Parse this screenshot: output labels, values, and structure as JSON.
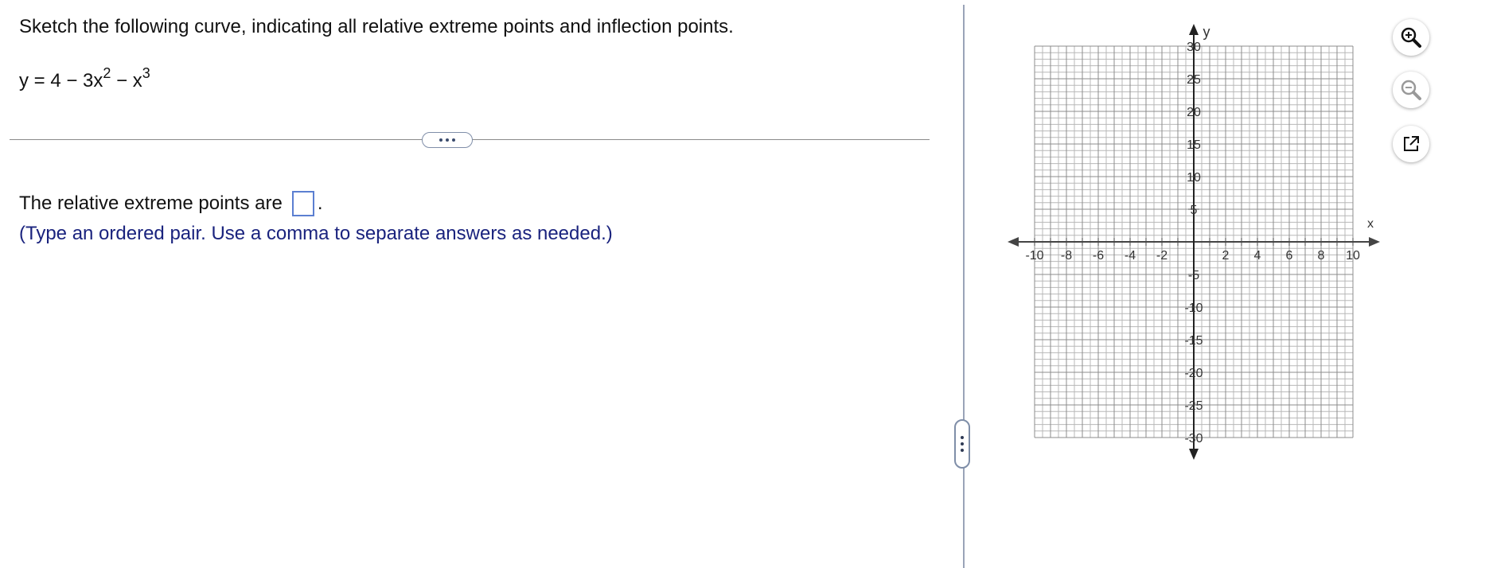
{
  "question": {
    "prompt": "Sketch the following curve, indicating all relative extreme points and inflection points.",
    "equation_prefix": "y = 4 − 3x",
    "exp1": "2",
    "equation_mid": " − x",
    "exp2": "3"
  },
  "answer": {
    "label": "The relative extreme points are",
    "suffix": ".",
    "box_value": "",
    "hint": "(Type an ordered pair. Use a comma to separate answers as needed.)"
  },
  "graph": {
    "x_axis_label": "x",
    "y_axis_label": "y",
    "x_range": [
      -10,
      10
    ],
    "y_range": [
      -30,
      30
    ],
    "x_tick_labels": [
      "-10",
      "-8",
      "-6",
      "-4",
      "-2",
      "2",
      "4",
      "6",
      "8",
      "10"
    ],
    "y_tick_labels": [
      "30",
      "25",
      "20",
      "15",
      "10",
      "5",
      "-5",
      "-10",
      "-15",
      "-20",
      "-25",
      "-30"
    ]
  },
  "toolbar": {
    "zoom_in_icon": "zoom-in-icon",
    "zoom_out_icon": "zoom-out-icon",
    "popout_icon": "pop-out-icon"
  }
}
